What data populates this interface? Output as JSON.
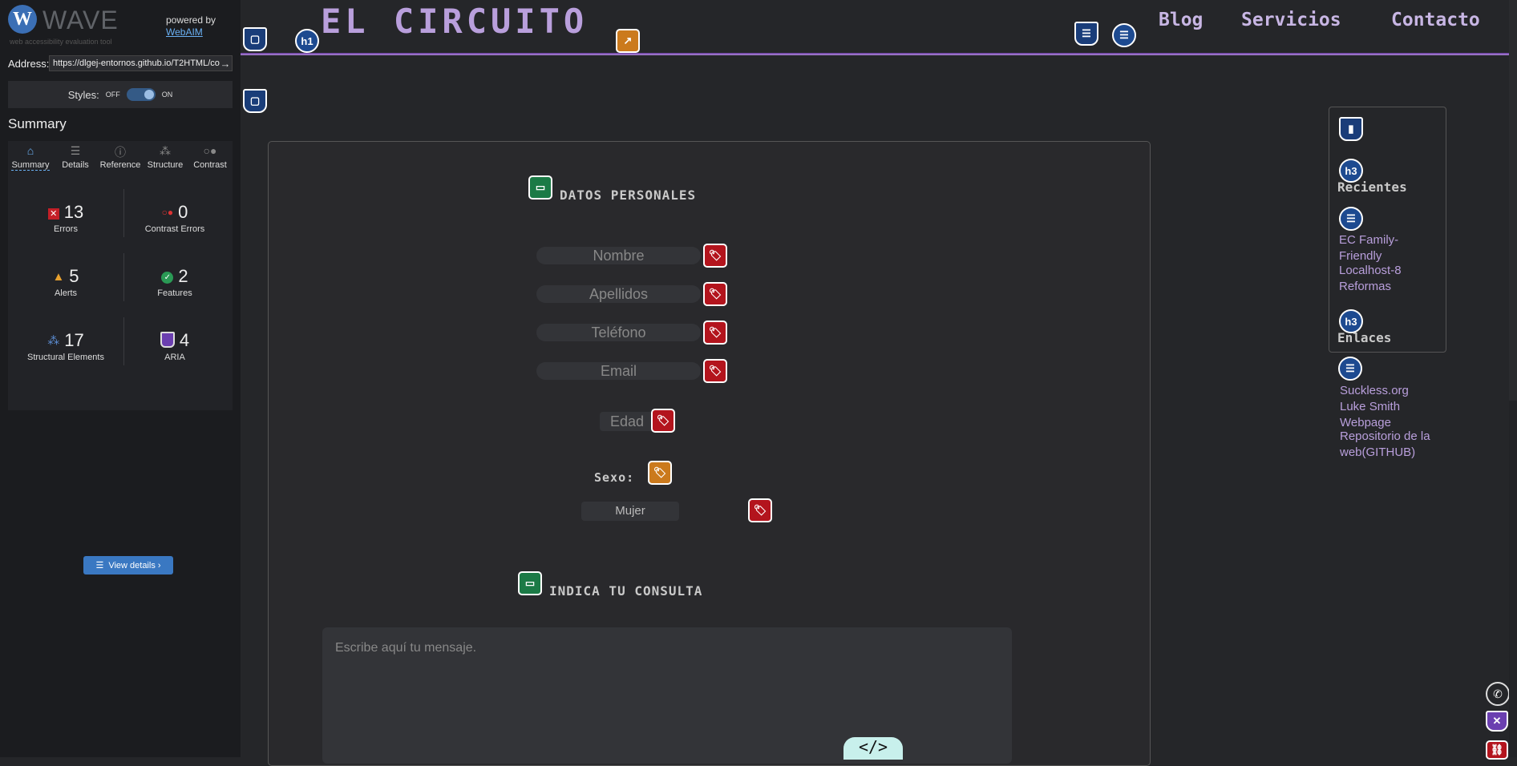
{
  "wave": {
    "name": "WAVE",
    "subtitle": "web accessibility evaluation tool",
    "powered_by": "powered by",
    "webaim": "WebAIM",
    "address_label": "Address:",
    "address_value": "https://dlgej-entornos.github.io/T2HTML/co",
    "styles_label": "Styles:",
    "styles_off": "OFF",
    "styles_on": "ON",
    "summary_title": "Summary",
    "tabs": [
      {
        "label": "Summary",
        "icon": "home-icon"
      },
      {
        "label": "Details",
        "icon": "list-icon"
      },
      {
        "label": "Reference",
        "icon": "info-icon"
      },
      {
        "label": "Structure",
        "icon": "hierarchy-icon"
      },
      {
        "label": "Contrast",
        "icon": "contrast-icon"
      }
    ],
    "stats": {
      "errors": {
        "count": "13",
        "label": "Errors"
      },
      "contrast": {
        "count": "0",
        "label": "Contrast Errors"
      },
      "alerts": {
        "count": "5",
        "label": "Alerts"
      },
      "features": {
        "count": "2",
        "label": "Features"
      },
      "structural": {
        "count": "17",
        "label": "Structural Elements"
      },
      "aria": {
        "count": "4",
        "label": "ARIA"
      }
    },
    "view_details": "View details ›"
  },
  "page": {
    "title": "EL CIRCUITO",
    "nav": [
      "Blog",
      "Servicios",
      "Contacto"
    ],
    "section1": "DATOS PERSONALES",
    "fields": [
      "Nombre",
      "Apellidos",
      "Teléfono",
      "Email"
    ],
    "edad": "Edad",
    "sexo_label": "Sexo:",
    "sexo_value": "Mujer",
    "section2": "INDICA TU CONSULTA",
    "message_placeholder": "Escribe aquí tu mensaje.",
    "code_badge": "</>",
    "aside": {
      "recientes": "Recientes",
      "recientes_links": [
        "EC Family-Friendly",
        "Localhost-8",
        "Reformas"
      ],
      "enlaces": "Enlaces",
      "enlaces_links": [
        "Suckless.org",
        "Luke Smith Webpage",
        "Repositorio de la web(GITHUB)"
      ]
    },
    "badges": {
      "h1": "h1",
      "h3": "h3"
    }
  },
  "colors": {
    "accent": "#b99fdc",
    "error": "#b3141d",
    "alert": "#cb7a1d",
    "feature": "#1b7a46",
    "structure": "#1a3d79"
  }
}
